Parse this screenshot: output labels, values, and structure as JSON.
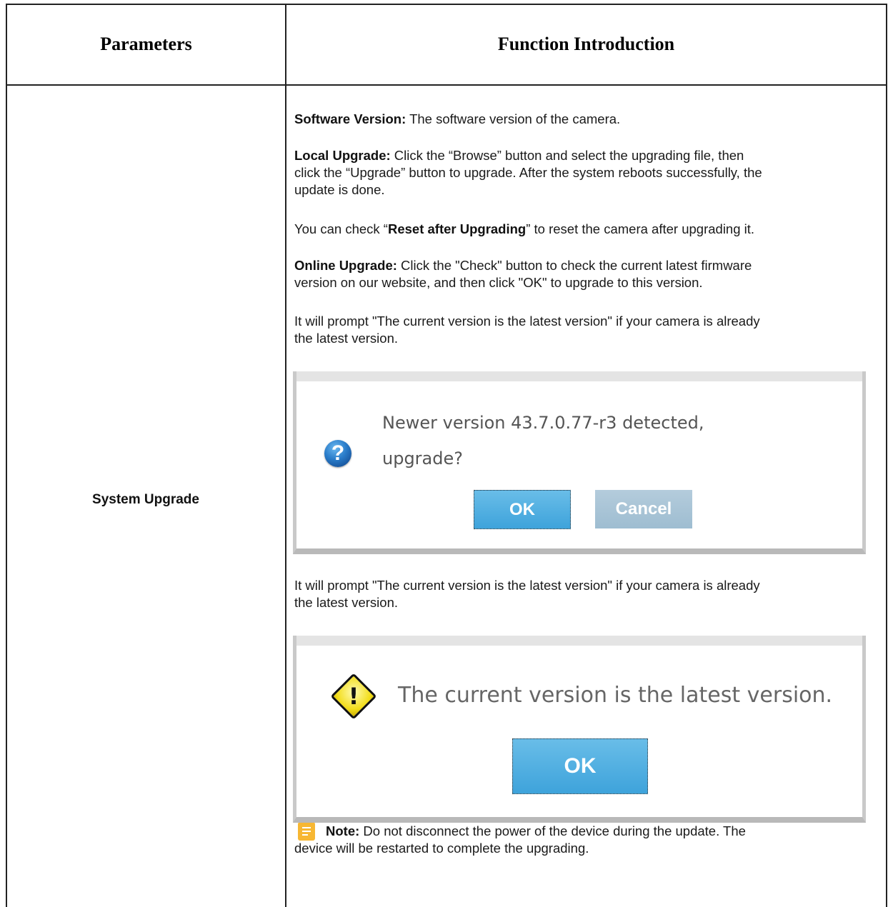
{
  "table": {
    "header_parameters": "Parameters",
    "header_function": "Function Introduction",
    "parameter_name": "System Upgrade"
  },
  "content": {
    "software_version_label": "Software Version:",
    "software_version_text": " The software version of the camera.",
    "local_upgrade_label": "Local Upgrade:",
    "local_upgrade_text_1": " Click the “Browse” button and select the upgrading file, then",
    "local_upgrade_text_2": "click the “Upgrade” button to upgrade. After the system reboots successfully, the",
    "local_upgrade_text_3": "update is done.",
    "reset_prefix": "You can check “",
    "reset_label": "Reset after Upgrading",
    "reset_suffix": "” to reset the camera after upgrading it.",
    "online_upgrade_label": "Online Upgrade:",
    "online_upgrade_text_1": " Click the \"Check\" button to check the current latest firmware",
    "online_upgrade_text_2": "version on our website, and then click \"OK\" to upgrade to this version.",
    "prompt_1_line_1": "It will prompt \"The current version is the latest version\" if your camera is already",
    "prompt_1_line_2": "the latest version.",
    "prompt_2_line_1": "It will prompt \"The current version is the latest version\" if your camera is already",
    "prompt_2_line_2": "the latest version.",
    "note_label": "Note:",
    "note_text_1": "  Do not disconnect the power of the device during the update. The",
    "note_text_2": "device will be restarted to complete the upgrading."
  },
  "dialog_upgrade": {
    "line_1": "Newer version 43.7.0.77-r3 detected,",
    "line_2": "upgrade?",
    "ok_label": "OK",
    "cancel_label": "Cancel",
    "icon": "question-icon"
  },
  "dialog_latest": {
    "message": "The current version is the latest version.",
    "ok_label": "OK",
    "icon": "warning-icon"
  },
  "colors": {
    "ok_button": "#4aaadf",
    "cancel_button": "#a8c4d7",
    "note_icon": "#f7b733"
  }
}
